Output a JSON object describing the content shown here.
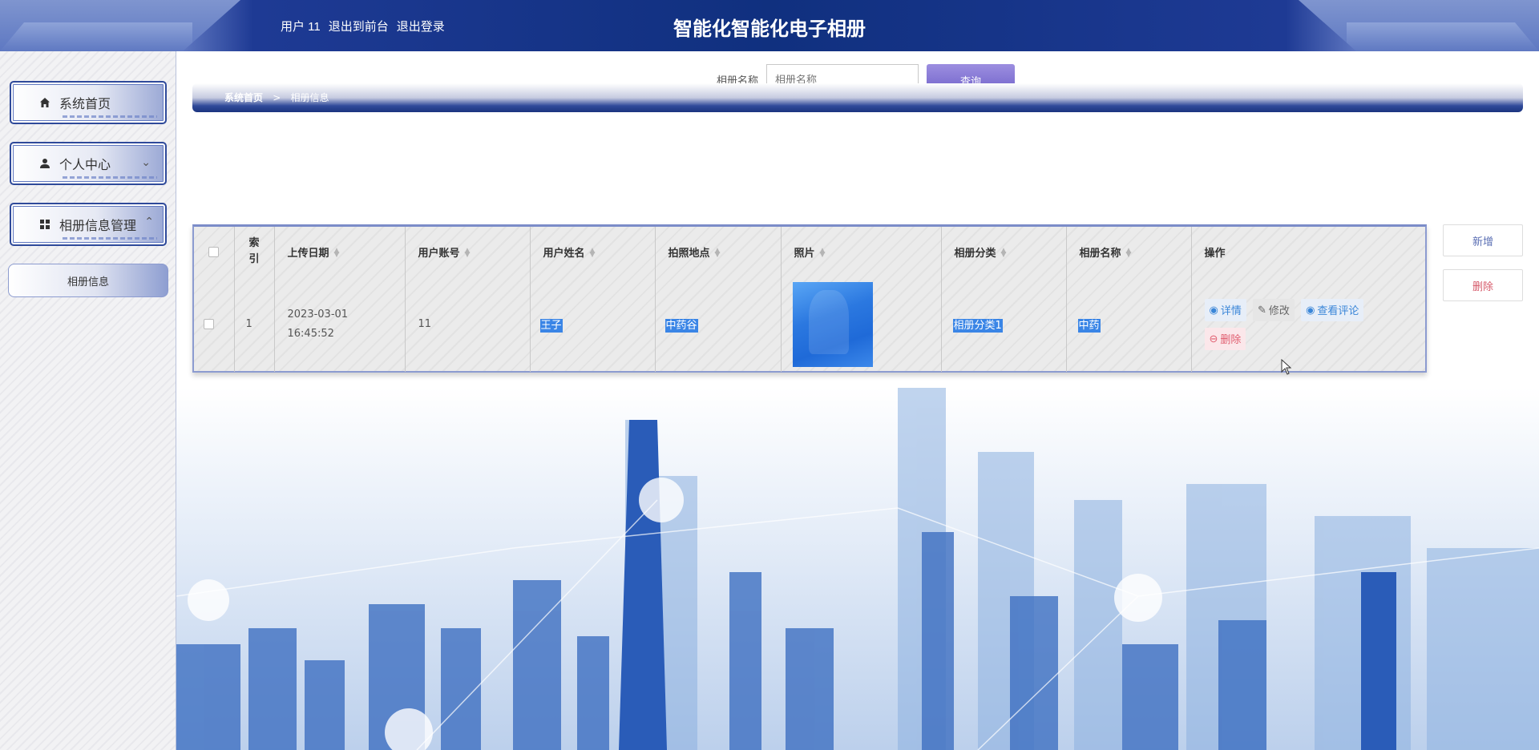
{
  "header": {
    "user_text": "用户 11",
    "back_front": "退出到前台",
    "logout": "退出登录",
    "title": "智能化智能化电子相册"
  },
  "sidebar": {
    "items": [
      {
        "label": "系统首页",
        "icon": "home-icon"
      },
      {
        "label": "个人中心",
        "icon": "user-icon"
      },
      {
        "label": "相册信息管理",
        "icon": "grid-icon"
      }
    ],
    "sub_item": "相册信息"
  },
  "breadcrumb": {
    "home": "系统首页",
    "separator": ">",
    "current": "相册信息"
  },
  "search": {
    "label": "相册名称",
    "placeholder": "相册名称",
    "button": "查询"
  },
  "table": {
    "headers": {
      "index": "索引",
      "upload_date": "上传日期",
      "user_account": "用户账号",
      "user_name": "用户姓名",
      "location": "拍照地点",
      "photo": "照片",
      "category": "相册分类",
      "album_name": "相册名称",
      "actions": "操作"
    },
    "rows": [
      {
        "index": "1",
        "upload_date": "2023-03-01 16:45:52",
        "user_account": "11",
        "user_name": "王子",
        "location": "中药谷",
        "category": "相册分类1",
        "album_name": "中药"
      }
    ],
    "actions": {
      "detail": "详情",
      "edit": "修改",
      "comments": "查看评论",
      "delete": "删除"
    }
  },
  "buttons": {
    "add": "新增",
    "delete": "删除"
  },
  "colors": {
    "header_dark": "#10307f",
    "accent_blue": "#3a85e6",
    "danger": "#d65a6a"
  }
}
